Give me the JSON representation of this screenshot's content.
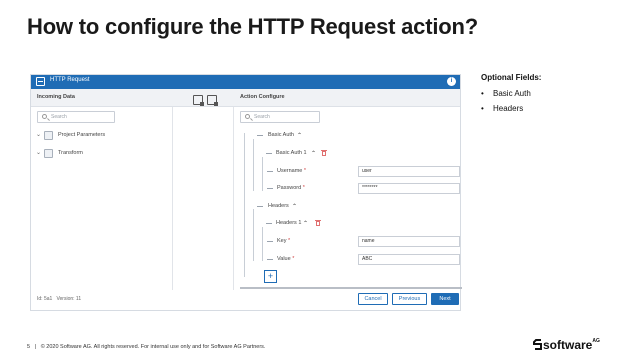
{
  "slide": {
    "title": "How to configure the HTTP Request action?",
    "footer": {
      "page_number": "5",
      "separator": "|",
      "copyright": "© 2020 Software AG. All rights reserved. For internal use only and for Software AG Partners.",
      "brand": "software",
      "brand_suffix": "AG"
    }
  },
  "dialog": {
    "title": "HTTP Request",
    "info_icon": "info-icon",
    "incoming": {
      "header": "Incoming Data",
      "search_placeholder": "Search",
      "items": [
        {
          "label": "Project Parameters",
          "icon": "parameters-icon"
        },
        {
          "label": "Transform",
          "icon": "transform-icon"
        }
      ]
    },
    "configure": {
      "header": "Action Configure",
      "search_placeholder": "Search",
      "basic_auth": {
        "label": "Basic Auth",
        "child_label": "Basic Auth 1",
        "username_label": "Username",
        "username_value": "user",
        "password_label": "Password",
        "password_value": "********"
      },
      "headers": {
        "label": "Headers",
        "child_label": "Headers 1",
        "key_label": "Key",
        "key_value": "name",
        "value_label": "Value",
        "value_value": "ABC"
      },
      "add_label": "+"
    },
    "footer": {
      "id_label": "Id: 5a1",
      "version_label": "Version: 11",
      "cancel": "Cancel",
      "previous": "Previous",
      "next": "Next"
    },
    "colors": {
      "accent": "#1f6cb5",
      "delete": "#e07070"
    }
  },
  "notes": {
    "title": "Optional Fields:",
    "items": [
      "Basic Auth",
      "Headers"
    ]
  }
}
